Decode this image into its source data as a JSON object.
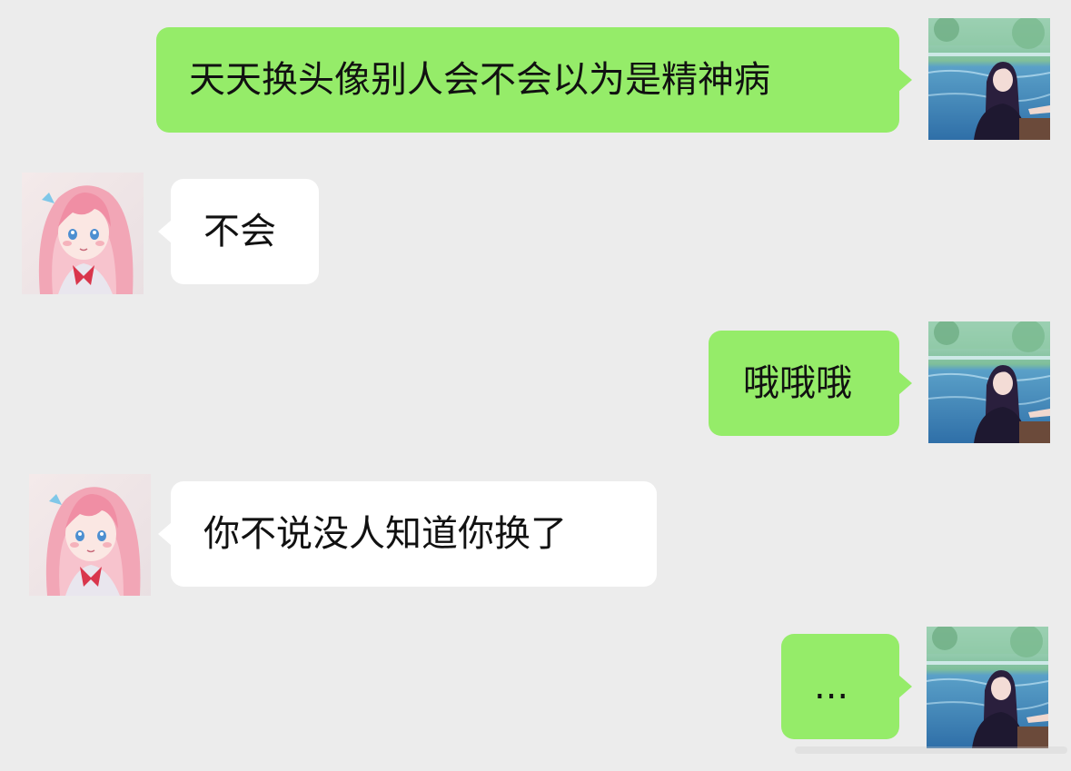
{
  "theme": {
    "chat_background": "#ececec",
    "outgoing_bubble": "#95ec69",
    "incoming_bubble": "#ffffff"
  },
  "participants": {
    "me": {
      "avatar_icon": "avatar-dark-haired-anime-girl"
    },
    "other": {
      "avatar_icon": "avatar-pink-haired-anime-girl"
    }
  },
  "messages": [
    {
      "sender": "me",
      "text": "天天换头像别人会不会以为是精神病"
    },
    {
      "sender": "other",
      "text": "不会"
    },
    {
      "sender": "me",
      "text": "哦哦哦"
    },
    {
      "sender": "other",
      "text": "你不说没人知道你换了"
    },
    {
      "sender": "me",
      "text": "..."
    }
  ]
}
